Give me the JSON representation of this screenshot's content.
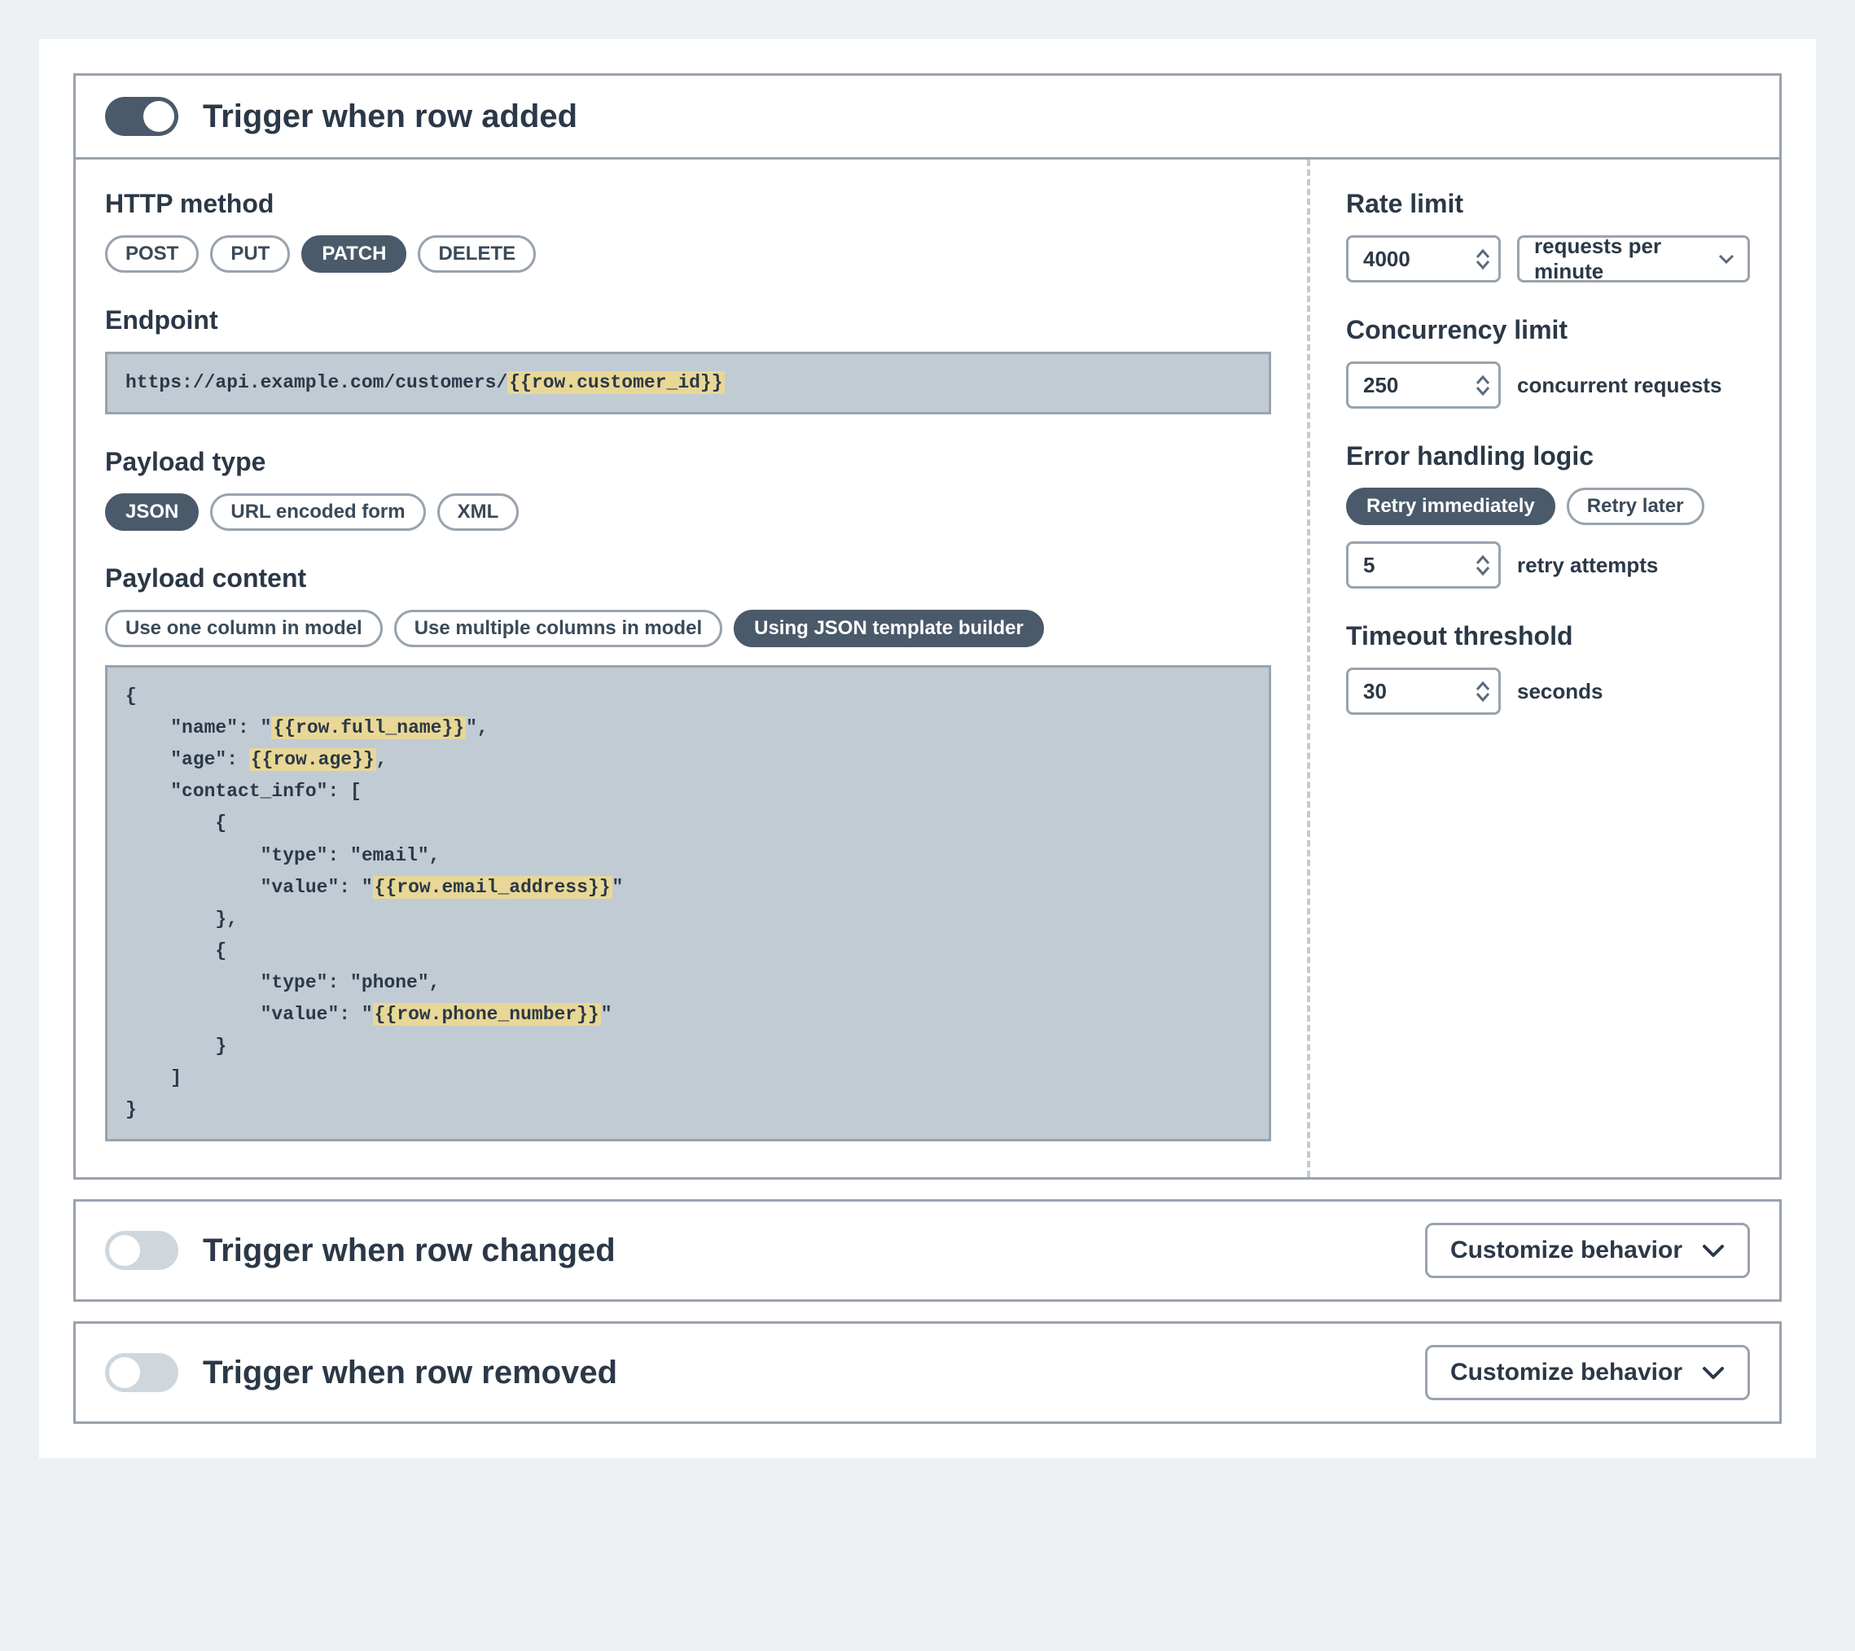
{
  "triggers": {
    "added": {
      "title": "Trigger when row added",
      "enabled": true,
      "http": {
        "methodLabel": "HTTP method",
        "options": [
          "POST",
          "PUT",
          "PATCH",
          "DELETE"
        ],
        "selected": "PATCH"
      },
      "endpoint": {
        "label": "Endpoint",
        "prefix": "https://api.example.com/customers/",
        "template": "{{row.customer_id}}"
      },
      "payloadType": {
        "label": "Payload type",
        "options": [
          "JSON",
          "URL encoded form",
          "XML"
        ],
        "selected": "JSON"
      },
      "payloadContent": {
        "label": "Payload content",
        "options": [
          "Use one column in model",
          "Use multiple columns in model",
          "Using JSON template builder"
        ],
        "selected": "Using JSON template builder",
        "json_lines": [
          {
            "text": "{"
          },
          {
            "text": "    \"name\": \"",
            "template": "{{row.full_name}}",
            "post": "\","
          },
          {
            "text": "    \"age\": ",
            "template": "{{row.age}}",
            "post": ","
          },
          {
            "text": "    \"contact_info\": ["
          },
          {
            "text": "        {"
          },
          {
            "text": "            \"type\": \"email\","
          },
          {
            "text": "            \"value\": \"",
            "template": "{{row.email_address}}",
            "post": "\""
          },
          {
            "text": "        },"
          },
          {
            "text": "        {"
          },
          {
            "text": "            \"type\": \"phone\","
          },
          {
            "text": "            \"value\": \"",
            "template": "{{row.phone_number}}",
            "post": "\""
          },
          {
            "text": "        }"
          },
          {
            "text": "    ]"
          },
          {
            "text": "}"
          }
        ]
      },
      "rateLimit": {
        "label": "Rate limit",
        "value": "4000",
        "unit": "requests per minute"
      },
      "concurrency": {
        "label": "Concurrency limit",
        "value": "250",
        "suffix": "concurrent requests"
      },
      "errorHandling": {
        "label": "Error handling logic",
        "options": [
          "Retry immediately",
          "Retry later"
        ],
        "selected": "Retry immediately",
        "retryValue": "5",
        "retrySuffix": "retry attempts"
      },
      "timeout": {
        "label": "Timeout threshold",
        "value": "30",
        "suffix": "seconds"
      }
    },
    "changed": {
      "title": "Trigger when row changed",
      "enabled": false,
      "buttonLabel": "Customize behavior"
    },
    "removed": {
      "title": "Trigger when row removed",
      "enabled": false,
      "buttonLabel": "Customize behavior"
    }
  }
}
